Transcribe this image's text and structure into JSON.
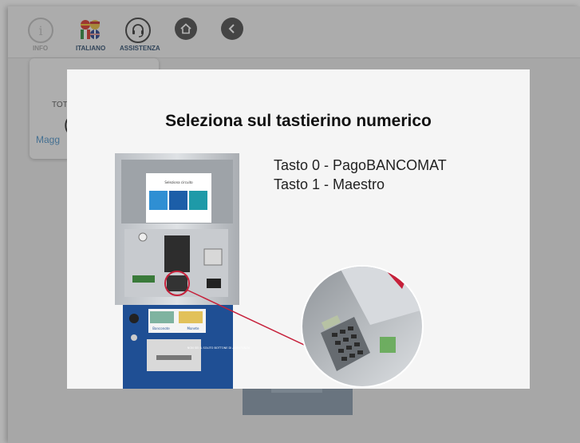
{
  "topbar": {
    "info_label": "INFO",
    "language_label": "ITALIANO",
    "assistance_label": "ASSISTENZA"
  },
  "background_card": {
    "total_label": "TOT",
    "paren_text": "(",
    "more_link": "Magg"
  },
  "modal": {
    "title": "Seleziona sul tastierino numerico",
    "key_lines": [
      "Tasto 0 - PagoBANCOMAT",
      "Tasto 1 - Maestro"
    ],
    "atm_screen_title": "Seleziona circuito",
    "atm_panel_labels": [
      "Banconote",
      "Monete"
    ],
    "atm_info_text": "NON SEI IL SOLITO BOTTONE DI ASSISTENZA"
  },
  "colors": {
    "accent_blue": "#1f4f94",
    "highlight_red": "#c6203a",
    "nav_dark": "#4a4a4a"
  },
  "icons": [
    "info-icon",
    "flags-icon",
    "headset-icon",
    "home-icon",
    "back-icon"
  ]
}
